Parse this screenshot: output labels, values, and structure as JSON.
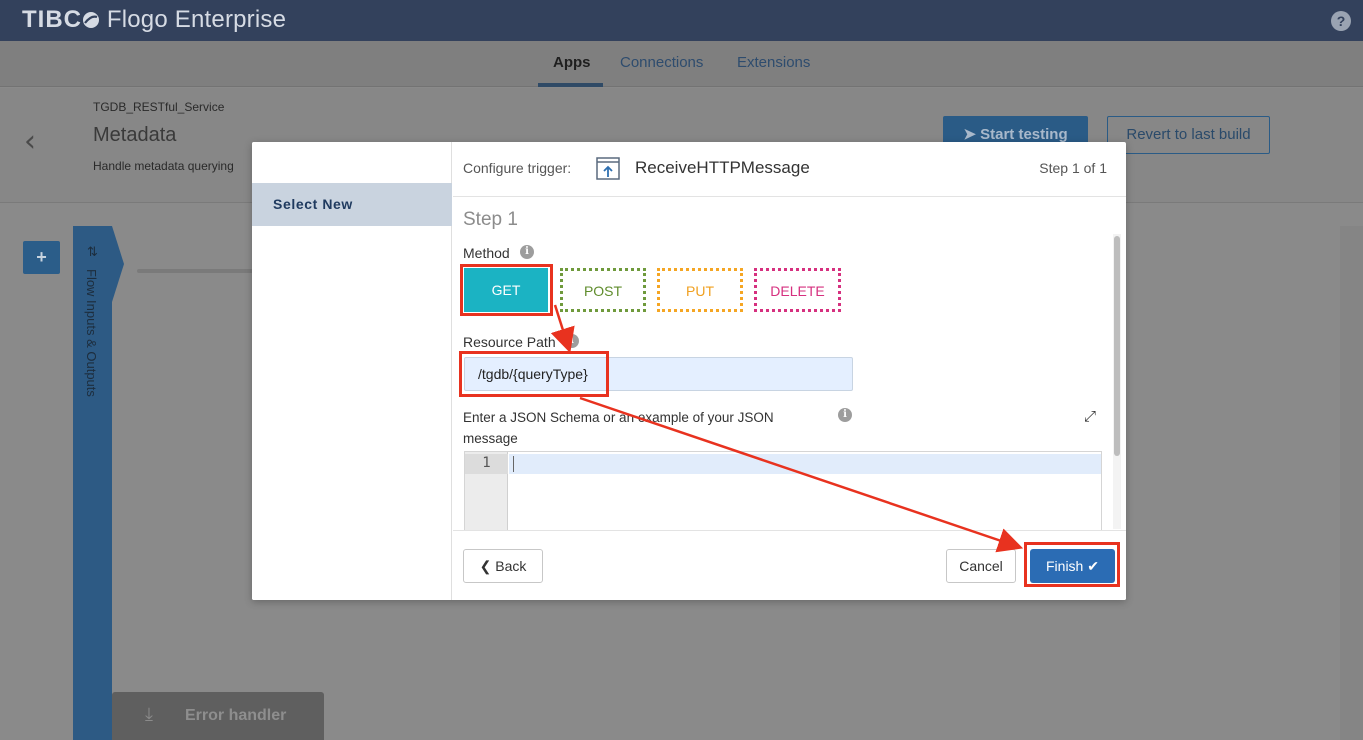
{
  "topbar": {
    "brand_tibco": "TIBC",
    "brand_rest": " Flogo",
    "brand_product": " Enterprise",
    "help_glyph": "?"
  },
  "nav": {
    "tabs": [
      "Apps",
      "Connections",
      "Extensions"
    ],
    "active": "Apps"
  },
  "header": {
    "app_name": "TGDB_RESTful_Service",
    "title": "Metadata",
    "description": "Handle metadata querying",
    "start_testing": "Start testing",
    "revert": "Revert to last build"
  },
  "canvas": {
    "add_label": "+",
    "flow_rail_label": "Flow Inputs & Outputs",
    "error_handler_label": "Error handler"
  },
  "modal": {
    "left_item": "Select New",
    "configure_label": "Configure trigger:",
    "trigger_name": "ReceiveHTTPMessage",
    "step_counter": "Step 1 of 1",
    "step_title": "Step 1",
    "method_label": "Method",
    "methods": [
      "GET",
      "POST",
      "PUT",
      "DELETE"
    ],
    "selected_method": "GET",
    "resource_path_label": "Resource Path",
    "resource_path_value": "/tgdb/{queryType}",
    "schema_label": "Enter a JSON Schema or an example of your JSON message",
    "editor_line_number": "1",
    "back": "Back",
    "cancel": "Cancel",
    "finish": "Finish"
  },
  "colors": {
    "topbar": "#33415c",
    "get": "#1bb3c3",
    "post": "#6f9a3c",
    "put": "#f5a623",
    "delete": "#d6307f",
    "finish": "#2b6cb4",
    "annotation": "#e8321f"
  },
  "icons": {
    "back": "chevron-left-icon",
    "trigger": "http-trigger-icon",
    "info": "info-icon",
    "expand": "expand-icon",
    "finish": "check-icon",
    "start_testing": "rocket-icon"
  }
}
